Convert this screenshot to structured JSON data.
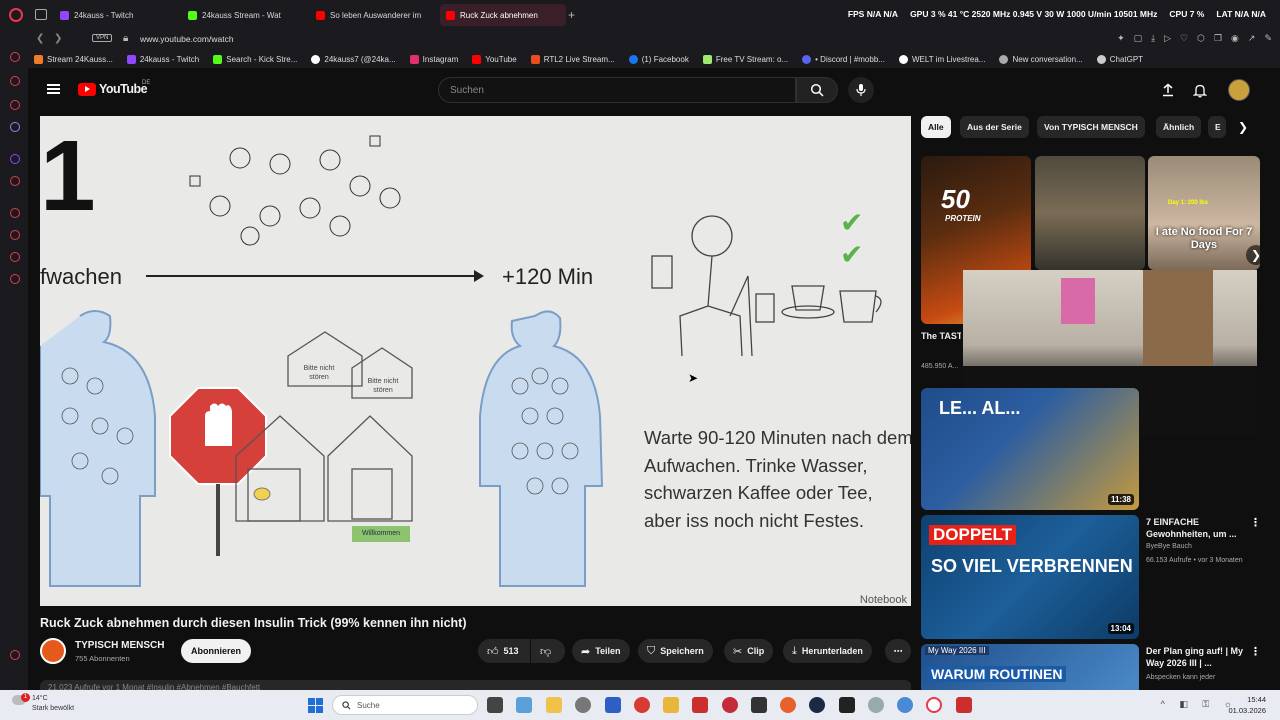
{
  "browser": {
    "tabs": [
      {
        "label": "24kauss - Twitch",
        "color": "#9146ff"
      },
      {
        "label": "24kauss Stream - Wat",
        "color": "#53fc18"
      },
      {
        "label": "So leben Auswanderer im",
        "color": "#ff0000"
      },
      {
        "label": "Ruck Zuck abnehmen",
        "color": "#ff0000"
      }
    ],
    "hw_stats": [
      "FPS",
      "N/A",
      "N/A",
      "GPU",
      "3 %",
      "41 °C",
      "2520 MHz",
      "0.945 V",
      "30 W",
      "1000 U/min",
      "10501 MHz",
      "CPU",
      "7 %",
      "LAT",
      "N/A",
      "N/A"
    ],
    "vpn_label": "VPN",
    "url": "www.youtube.com/watch",
    "bookmarks": [
      {
        "label": "Stream 24Kauss...",
        "color": "#f07a2a"
      },
      {
        "label": "24kauss - Twitch",
        "color": "#9146ff"
      },
      {
        "label": "Search - Kick Stre...",
        "color": "#53fc18"
      },
      {
        "label": "24kauss7 (@24ka...",
        "color": "#ffffff"
      },
      {
        "label": "Instagram",
        "color": "#e1306c"
      },
      {
        "label": "YouTube",
        "color": "#ff0000"
      },
      {
        "label": "RTL2 Live Stream...",
        "color": "#e84e1c"
      },
      {
        "label": "(1) Facebook",
        "color": "#1877f2"
      },
      {
        "label": "Free TV Stream: o...",
        "color": "#9fe870"
      },
      {
        "label": "• Discord | #mobb...",
        "color": "#5865f2"
      },
      {
        "label": "WELT im Livestrea...",
        "color": "#ffffff"
      },
      {
        "label": "New conversation...",
        "color": "#aaaaaa"
      },
      {
        "label": "ChatGPT",
        "color": "#cccccc"
      }
    ]
  },
  "youtube": {
    "logo_text": "YouTube",
    "country": "DE",
    "search_placeholder": "Suchen",
    "video": {
      "slide_number": "1",
      "wake_label": "fwachen",
      "time_label": "+120 Min",
      "sign_left": "Bitte nicht stören",
      "sign_right": "Bitte nicht stören",
      "welcome": "Willkommen",
      "body_text": "Warte 90-120 Minuten nach dem Aufwachen. Trinke Wasser, schwarzen Kaffee oder Tee, aber iss noch nicht Festes.",
      "brand": "Notebook"
    },
    "title": "Ruck Zuck abnehmen durch diesen Insulin Trick (99% kennen ihn nicht)",
    "channel": {
      "name": "TYPISCH MENSCH",
      "subs": "755 Abonnenten"
    },
    "subscribe_label": "Abonnieren",
    "actions": {
      "likes": "513",
      "share": "Teilen",
      "save": "Speichern",
      "clip": "Clip",
      "download": "Herunterladen"
    },
    "description_peek": "21.023 Aufrufe  vor 1 Monat  #Insulin #Abnehmen #Bauchfett",
    "chips": [
      "Alle",
      "Aus der Serie",
      "Von TYPISCH MENSCH",
      "Ähnlich",
      "E"
    ],
    "recommendations": [
      {
        "title": "The TAST... High Pro...",
        "meta": "485.950 A..."
      },
      {
        "thumb_text": "LE... AL...",
        "duration": "11:38"
      },
      {
        "title": "7 EINFACHE Gewohnheiten, um ...",
        "channel": "ByeBye Bauch",
        "meta": "66.153 Aufrufe • vor 3 Monaten",
        "thumb_a": "DOPPELT",
        "thumb_b": "SO VIEL VERBRENNEN",
        "duration": "13:04"
      },
      {
        "title": "Der Plan ging auf! | My Way 2026 III | ...",
        "channel": "Abspecken kann jeder",
        "thumb_a": "My Way 2026 III",
        "thumb_b": "WARUM ROUTINEN"
      }
    ],
    "thumb_texts": {
      "protein_num": "50",
      "protein": "PROTEIN",
      "ate": "I ate No food For 7 Days",
      "day": "Day 1: 200 lbs"
    }
  },
  "taskbar": {
    "weather_temp": "14°C",
    "weather_desc": "Stark bewölkt",
    "notification_count": "1",
    "search_label": "Suche",
    "time": "15:44",
    "date": "01.03.2026"
  }
}
